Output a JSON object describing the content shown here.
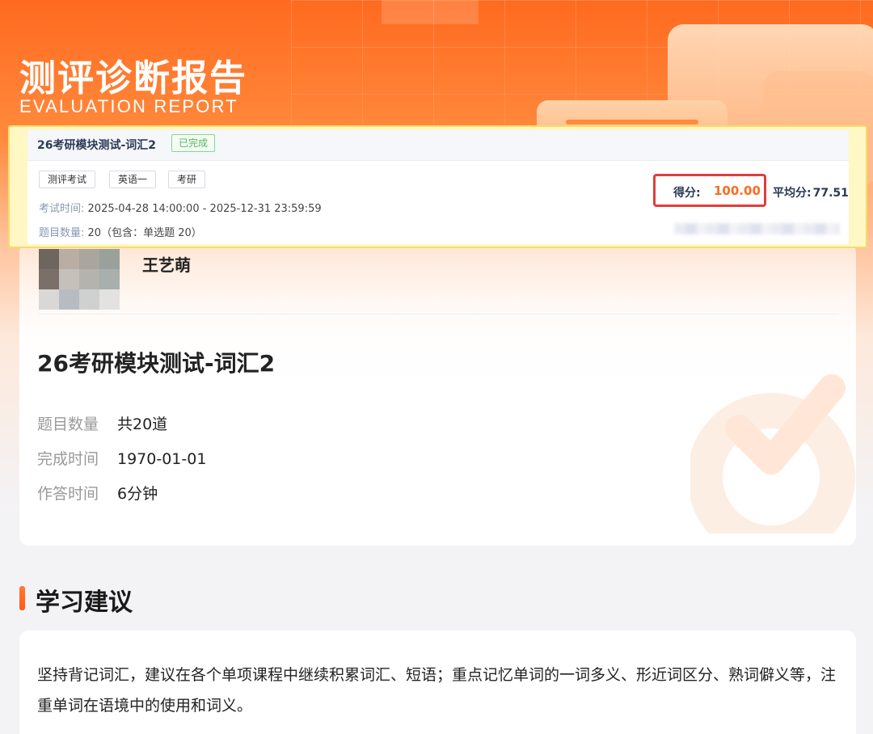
{
  "header": {
    "title": "测评诊断报告",
    "subtitle": "EVALUATION REPORT"
  },
  "exam_card": {
    "name": "26考研模块测试-词汇2",
    "status": "已完成",
    "tags": [
      "测评考试",
      "英语一",
      "考研"
    ],
    "exam_time_label": "考试时间:",
    "exam_time_value": "2025-04-28 14:00:00 - 2025-12-31 23:59:59",
    "question_count_label": "题目数量:",
    "question_count_value": "20（包含：单选题 20）",
    "score_label": "得分:",
    "score_value": "100.00",
    "avg_label": "平均分:",
    "avg_value": "77.51"
  },
  "user": {
    "name": "王艺萌"
  },
  "report": {
    "title": "26考研模块测试-词汇2",
    "stats": [
      {
        "label": "题目数量",
        "value": "共20道"
      },
      {
        "label": "完成时间",
        "value": "1970-01-01"
      },
      {
        "label": "作答时间",
        "value": "6分钟"
      }
    ]
  },
  "suggestion": {
    "title": "学习建议",
    "text": "坚持背记词汇，建议在各个单项课程中继续积累词汇、短语；重点记忆单词的一词多义、形近词区分、熟词僻义等，注重单词在语境中的使用和词义。"
  },
  "colors": {
    "accent": "#ff6a1f",
    "highlight_border": "#e03e3e",
    "done_green": "#56b75c"
  }
}
